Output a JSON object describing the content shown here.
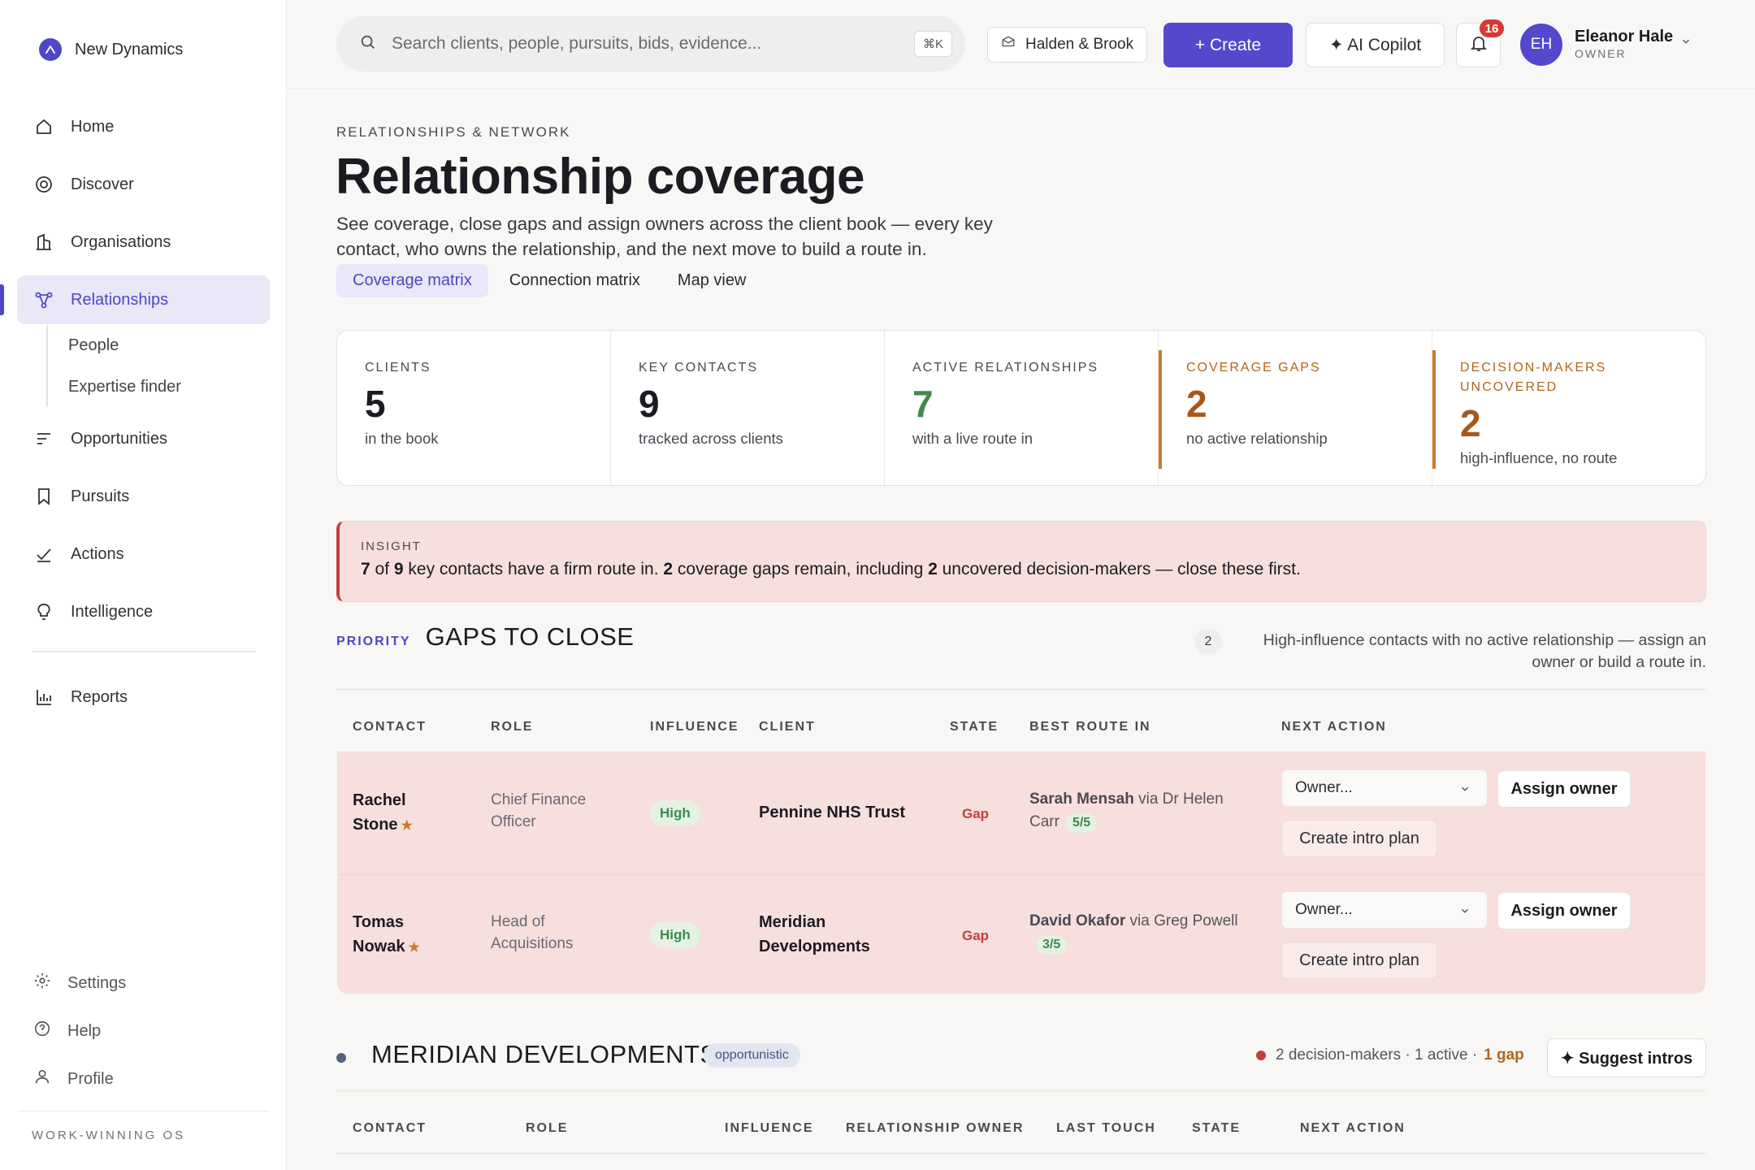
{
  "brand": {
    "name": "New Dynamics"
  },
  "nav": {
    "items": [
      {
        "label": "Home",
        "icon": "home-icon"
      },
      {
        "label": "Discover",
        "icon": "compass-icon"
      },
      {
        "label": "Organisations",
        "icon": "building-icon"
      },
      {
        "label": "Relationships",
        "icon": "network-icon"
      },
      {
        "label": "Opportunities",
        "icon": "list-icon"
      },
      {
        "label": "Pursuits",
        "icon": "bookmark-icon"
      },
      {
        "label": "Actions",
        "icon": "check-icon"
      },
      {
        "label": "Intelligence",
        "icon": "lightbulb-icon"
      },
      {
        "label": "Reports",
        "icon": "bar-chart-icon"
      }
    ],
    "sub_items": [
      "People",
      "Expertise finder"
    ],
    "bottom": [
      {
        "label": "Settings",
        "icon": "gear-icon"
      },
      {
        "label": "Help",
        "icon": "help-icon"
      },
      {
        "label": "Profile",
        "icon": "user-icon"
      }
    ],
    "footer": "WORK-WINNING OS"
  },
  "topbar": {
    "search_placeholder": "Search clients, people, pursuits, bids, evidence...",
    "search_shortcut": "⌘K",
    "workspace": "Halden & Brook",
    "create_label": "+ Create",
    "ai_label": "✦ AI Copilot",
    "notifications": "16",
    "user": {
      "initials": "EH",
      "name": "Eleanor Hale",
      "role": "OWNER"
    }
  },
  "page": {
    "eyebrow": "RELATIONSHIPS & NETWORK",
    "title": "Relationship coverage",
    "description": "See coverage, close gaps and assign owners across the client book — every key contact, who owns the relationship, and the next move to build a route in.",
    "tabs": [
      "Coverage matrix",
      "Connection matrix",
      "Map view"
    ]
  },
  "stats": [
    {
      "label": "CLIENTS",
      "value": "5",
      "sub": "in the book"
    },
    {
      "label": "KEY CONTACTS",
      "value": "9",
      "sub": "tracked across clients"
    },
    {
      "label": "ACTIVE RELATIONSHIPS",
      "value": "7",
      "sub": "with a live route in"
    },
    {
      "label": "COVERAGE GAPS",
      "value": "2",
      "sub": "no active relationship"
    },
    {
      "label": "DECISION-MAKERS UNCOVERED",
      "value": "2",
      "sub": "high-influence, no route"
    }
  ],
  "insight": {
    "label": "INSIGHT",
    "a": "7",
    "b": " of ",
    "c": "9",
    "d": " key contacts have a firm route in. ",
    "e": "2",
    "f": " coverage gaps remain, including ",
    "g": "2",
    "h": " uncovered decision-makers — close these first."
  },
  "gaps": {
    "eyebrow": "PRIORITY",
    "title": "GAPS TO CLOSE",
    "count": "2",
    "note": "High-influence contacts with no active relationship — assign an owner or build a route in.",
    "columns": [
      "CONTACT",
      "ROLE",
      "INFLUENCE",
      "CLIENT",
      "STATE",
      "BEST ROUTE IN",
      "NEXT ACTION"
    ],
    "rows": [
      {
        "name": "Rachel Stone",
        "role": "Chief Finance Officer",
        "influence": "High",
        "client": "Pennine NHS Trust",
        "state": "Gap",
        "route_person": "Sarah Mensah",
        "route_via": " via Dr Helen Carr",
        "route_score": "5/5",
        "owner_placeholder": "Owner...",
        "assign": "Assign owner",
        "intro": "Create intro plan"
      },
      {
        "name": "Tomas Nowak",
        "role": "Head of Acquisitions",
        "influence": "High",
        "client": "Meridian Developments",
        "state": "Gap",
        "route_person": "David Okafor",
        "route_via": " via Greg Powell",
        "route_score": "3/5",
        "owner_placeholder": "Owner...",
        "assign": "Assign owner",
        "intro": "Create intro plan"
      }
    ]
  },
  "meridian": {
    "title": "MERIDIAN DEVELOPMENTS",
    "tag": "opportunistic",
    "stats_a": "2 decision-makers · 1 active ·",
    "stats_gap": "1 gap",
    "suggest": "✦ Suggest intros",
    "columns": [
      "CONTACT",
      "ROLE",
      "INFLUENCE",
      "RELATIONSHIP OWNER",
      "LAST TOUCH",
      "STATE",
      "NEXT ACTION"
    ]
  },
  "colors": {
    "accent": "#5448cc",
    "gap_red": "#c2403a",
    "warn_orange": "#b0661c",
    "good_green": "#3f8a4d"
  }
}
